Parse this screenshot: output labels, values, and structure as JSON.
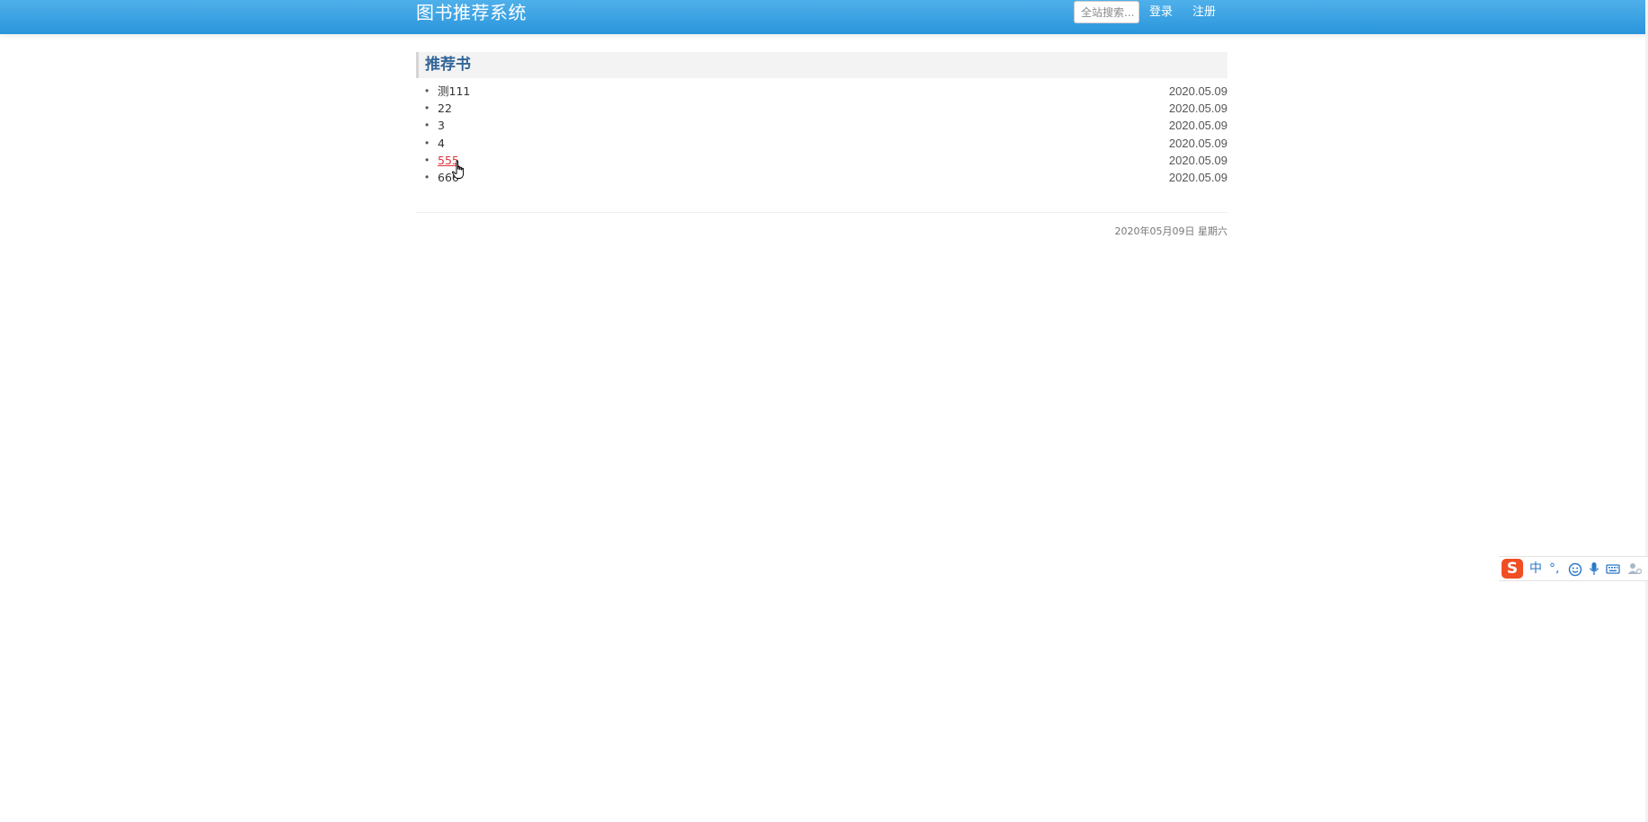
{
  "header": {
    "brand": "图书推荐系统",
    "search_placeholder": "全站搜索...",
    "login": "登录",
    "register": "注册"
  },
  "section": {
    "title": "推荐书"
  },
  "books": [
    {
      "title": "测111",
      "date": "2020.05.09"
    },
    {
      "title": "22",
      "date": "2020.05.09"
    },
    {
      "title": "3",
      "date": "2020.05.09"
    },
    {
      "title": "4",
      "date": "2020.05.09"
    },
    {
      "title": "555",
      "date": "2020.05.09"
    },
    {
      "title": "666",
      "date": "2020.05.09"
    }
  ],
  "footer": {
    "date": "2020年05月09日 星期六"
  },
  "ime": {
    "logo": "S",
    "mode": "中",
    "punct": "°,",
    "icons": [
      "emoji-icon",
      "microphone-icon",
      "keyboard-icon",
      "user-icon"
    ]
  },
  "colors": {
    "header_bg": "#3aa3e3",
    "section_title": "#336699",
    "link_hover": "#e0333a",
    "ime_logo": "#f04e23"
  }
}
